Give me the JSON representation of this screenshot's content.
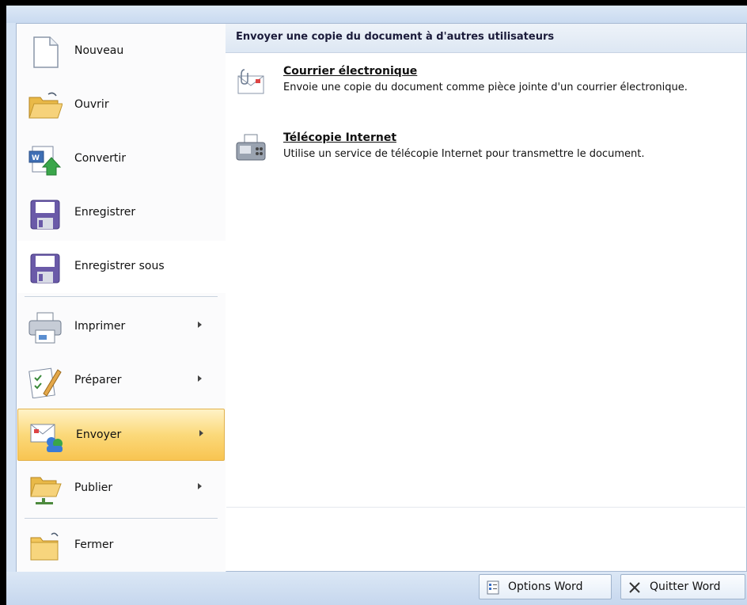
{
  "menu": {
    "items": [
      {
        "label": "Nouveau",
        "icon": "new-document-icon",
        "mnemonic": "N"
      },
      {
        "label": "Ouvrir",
        "icon": "open-folder-icon",
        "mnemonic": "O"
      },
      {
        "label": "Convertir",
        "icon": "convert-icon",
        "mnemonic": "C"
      },
      {
        "label": "Enregistrer",
        "icon": "save-icon",
        "mnemonic": "E"
      },
      {
        "label": "Enregistrer sous",
        "icon": "save-as-icon",
        "mnemonic": "s"
      },
      {
        "label": "Imprimer",
        "icon": "printer-icon",
        "mnemonic": "p"
      },
      {
        "label": "Préparer",
        "icon": "prepare-icon",
        "mnemonic": "é"
      },
      {
        "label": "Envoyer",
        "icon": "send-icon",
        "mnemonic": "y",
        "selected": true
      },
      {
        "label": "Publier",
        "icon": "publish-icon",
        "mnemonic": "b"
      },
      {
        "label": "Fermer",
        "icon": "close-folder-icon",
        "mnemonic": "F"
      }
    ]
  },
  "pane": {
    "header": "Envoyer une copie du document à d'autres utilisateurs",
    "options": [
      {
        "title": "Courrier électronique",
        "description": "Envoie une copie du document comme pièce jointe d'un courrier électronique.",
        "icon": "email-icon"
      },
      {
        "title": "Télécopie Internet",
        "description": "Utilise un service de télécopie Internet pour transmettre le document.",
        "icon": "fax-icon"
      }
    ]
  },
  "footer": {
    "options_label": "Options Word",
    "quit_label": "Quitter Word"
  },
  "colors": {
    "selected_gradient_top": "#fff2c6",
    "selected_gradient_bottom": "#f8c451",
    "frame_blue": "#d5e3f4"
  }
}
